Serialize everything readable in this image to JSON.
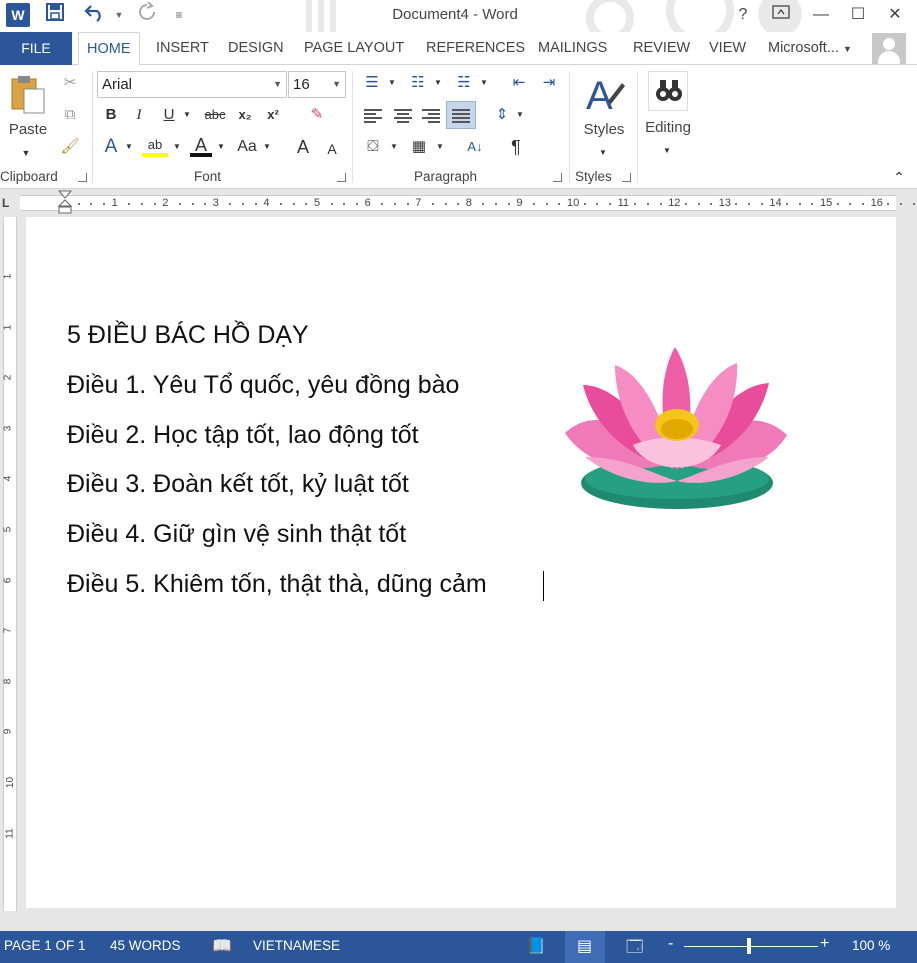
{
  "app": {
    "title": "Document4 - Word",
    "help": "?",
    "window_controls": [
      "restore-ribbon",
      "minimize",
      "maximize",
      "close"
    ]
  },
  "qat": {
    "word_logo": "W",
    "save_icon": "save-icon",
    "undo_icon": "undo-icon",
    "redo_icon": "redo-icon"
  },
  "tabs": [
    {
      "label": "FILE"
    },
    {
      "label": "HOME"
    },
    {
      "label": "INSERT"
    },
    {
      "label": "DESIGN"
    },
    {
      "label": "PAGE LAYOUT"
    },
    {
      "label": "REFERENCES"
    },
    {
      "label": "MAILINGS"
    },
    {
      "label": "REVIEW"
    },
    {
      "label": "VIEW"
    }
  ],
  "account": {
    "label": "Microsoft..."
  },
  "ribbon": {
    "clipboard": {
      "label": "Clipboard",
      "paste": "Paste"
    },
    "font": {
      "label": "Font",
      "font_name": "Arial",
      "font_size": "16",
      "bold": "B",
      "italic": "I",
      "underline": "U",
      "strike": "abc",
      "subscript": "x₂",
      "superscript": "x²",
      "change_case": "Aa",
      "grow": "A",
      "shrink": "A"
    },
    "paragraph": {
      "label": "Paragraph"
    },
    "styles": {
      "label": "Styles",
      "button": "Styles"
    },
    "editing": {
      "button": "Editing"
    }
  },
  "ruler": {
    "numbers": [
      "1",
      "2",
      "3",
      "4",
      "5",
      "6",
      "7",
      "8",
      "9",
      "10",
      "11",
      "12",
      "13",
      "14",
      "15",
      "16"
    ],
    "tab_selector": "L"
  },
  "vruler": {
    "numbers": [
      "1",
      "1",
      "2",
      "3",
      "4",
      "5",
      "6",
      "7",
      "8",
      "9",
      "10",
      "11"
    ]
  },
  "document": {
    "lines": [
      "5 ĐIỀU BÁC HỒ DẠY",
      "Điều 1. Yêu Tổ quốc, yêu đồng bào",
      "Điều 2. Học tập tốt, lao động tốt",
      "Điều 3. Đoàn kết tốt, kỷ luật tốt",
      "Điều 4. Giữ gìn vệ sinh thật tốt",
      "Điều 5. Khiêm tốn, thật thà, dũng cảm"
    ],
    "image": "lotus-flower"
  },
  "status": {
    "page": "PAGE 1 OF 1",
    "words": "45 WORDS",
    "language": "VIETNAMESE",
    "zoom": "100 %",
    "zoom_minus": "-",
    "zoom_plus": "+"
  },
  "colors": {
    "accent": "#2b579a",
    "lotus_pink": "#e84c9a",
    "lotus_leaf": "#1f8a70"
  }
}
